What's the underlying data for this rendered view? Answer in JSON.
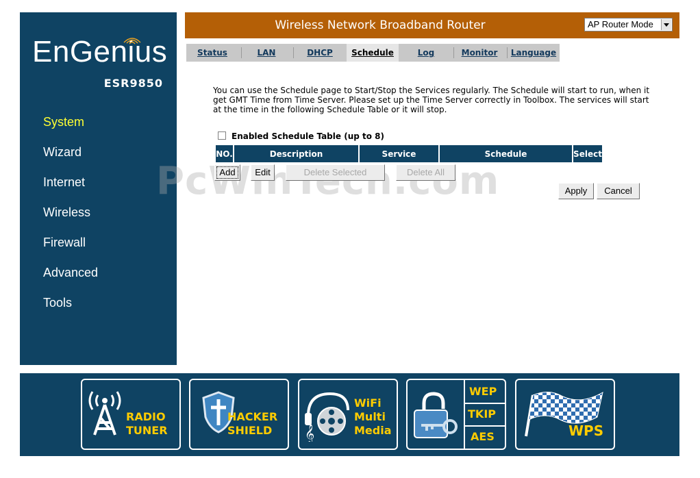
{
  "sidebar": {
    "logo": "EnGenius",
    "model": "ESR9850",
    "items": [
      {
        "label": "System"
      },
      {
        "label": "Wizard"
      },
      {
        "label": "Internet"
      },
      {
        "label": "Wireless"
      },
      {
        "label": "Firewall"
      },
      {
        "label": "Advanced"
      },
      {
        "label": "Tools"
      }
    ]
  },
  "header": {
    "title": "Wireless Network Broadband Router",
    "mode_select": "AP Router Mode"
  },
  "tabs": [
    "Status",
    "LAN",
    "DHCP",
    "Schedule",
    "Log",
    "Monitor",
    "Language"
  ],
  "active_tab": "Schedule",
  "main": {
    "intro": "You can use the Schedule page to Start/Stop the Services regularly. The Schedule will start to run, when it get GMT Time from Time Server. Please set up the Time Server correctly in Toolbox. The services will start at the time in the following Schedule Table or it will stop.",
    "enable_label": "Enabled Schedule Table (up to 8)",
    "table_headers": [
      "NO.",
      "Description",
      "Service",
      "Schedule",
      "Select"
    ],
    "buttons": {
      "add": "Add",
      "edit": "Edit",
      "delete_selected": "Delete Selected",
      "delete_all": "Delete All",
      "apply": "Apply",
      "cancel": "Cancel"
    }
  },
  "watermark": "PcWinTech.com",
  "footer": {
    "radio_line1": "RADIO",
    "radio_line2": "TUNER",
    "hacker_line1": "HACKER",
    "hacker_line2": "SHIELD",
    "wifi_line1": "WiFi",
    "wifi_line2": "Multi",
    "wifi_line3": "Media",
    "sec_wep": "WEP",
    "sec_tkip": "TKIP",
    "sec_aes": "AES",
    "wps": "WPS"
  },
  "colors": {
    "navy": "#0f4363",
    "header_orange": "#b45f06",
    "active_nav": "#ffff33",
    "footer_text": "#ffcc00"
  }
}
